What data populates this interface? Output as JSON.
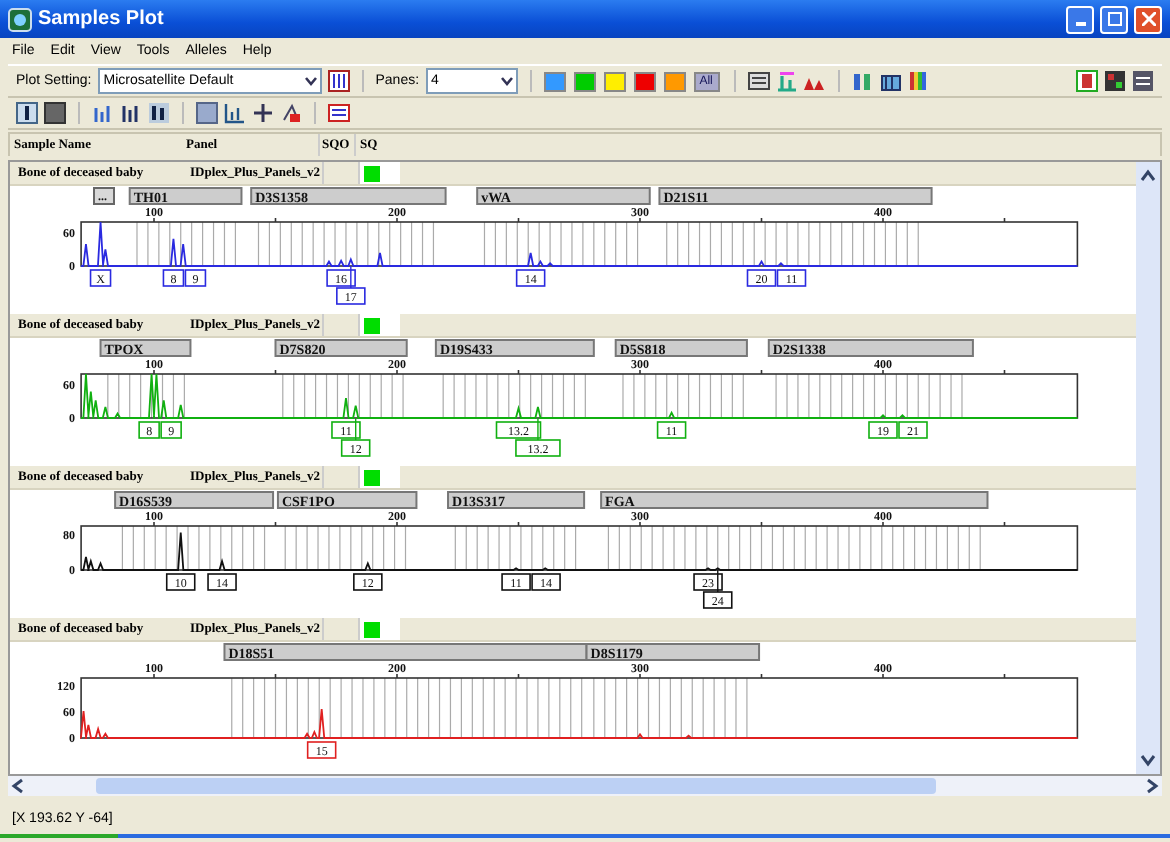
{
  "window": {
    "title": "Samples Plot"
  },
  "menu": [
    "File",
    "Edit",
    "View",
    "Tools",
    "Alleles",
    "Help"
  ],
  "toolbar": {
    "plot_setting_label": "Plot Setting:",
    "plot_setting": "Microsatellite Default",
    "panes_label": "Panes:",
    "panes": "4",
    "dye_buttons": [
      {
        "color": "#3399ff"
      },
      {
        "color": "#00cc00"
      },
      {
        "color": "#ffee00"
      },
      {
        "color": "#ee0000"
      },
      {
        "color": "#ff9900"
      },
      {
        "label": "All"
      }
    ]
  },
  "columns": [
    "Sample Name",
    "Panel",
    "SQO",
    "SQ"
  ],
  "panels": [
    {
      "sample": "Bone of deceased baby",
      "panel": "IDplex_Plus_Panels_v2",
      "sq": {
        "color": "#00dd00"
      },
      "color": "#2a2ae0",
      "more_button": "...",
      "loci": [
        "TH01",
        "D3S1358",
        "vWA",
        "D21S11"
      ],
      "xticks": [
        "100",
        "200",
        "300",
        "400"
      ],
      "yticks": [
        "60",
        "0"
      ],
      "alleles": [
        {
          "label": "X",
          "lower": false
        },
        {
          "label": "8",
          "lower": false
        },
        {
          "label": "9",
          "lower": false
        },
        {
          "label": "16",
          "lower": false
        },
        {
          "label": "17",
          "lower": true
        },
        {
          "label": "14",
          "lower": false
        },
        {
          "label": "20",
          "lower": false
        },
        {
          "label": "11",
          "lower": false
        }
      ]
    },
    {
      "sample": "Bone of deceased baby",
      "panel": "IDplex_Plus_Panels_v2",
      "sq": {
        "color": "#00dd00"
      },
      "color": "#10b010",
      "loci": [
        "TPOX",
        "D7S820",
        "D19S433",
        "D5S818",
        "D2S1338"
      ],
      "xticks": [
        "100",
        "200",
        "300",
        "400"
      ],
      "yticks": [
        "60",
        "0"
      ],
      "alleles": [
        {
          "label": "8",
          "lower": false
        },
        {
          "label": "9",
          "lower": false
        },
        {
          "label": "11",
          "lower": false
        },
        {
          "label": "12",
          "lower": true
        },
        {
          "label": "13.2",
          "lower": false
        },
        {
          "label": "13.2",
          "lower": true
        },
        {
          "label": "11",
          "lower": false
        },
        {
          "label": "19",
          "lower": false
        },
        {
          "label": "21",
          "lower": false
        }
      ]
    },
    {
      "sample": "Bone of deceased baby",
      "panel": "IDplex_Plus_Panels_v2",
      "sq": {
        "color": "#00dd00"
      },
      "color": "#111111",
      "loci": [
        "D16S539",
        "CSF1PO",
        "D13S317",
        "FGA"
      ],
      "xticks": [
        "100",
        "200",
        "300",
        "400"
      ],
      "yticks": [
        "80",
        "0"
      ],
      "alleles": [
        {
          "label": "10",
          "lower": false
        },
        {
          "label": "14",
          "lower": false
        },
        {
          "label": "12",
          "lower": false
        },
        {
          "label": "11",
          "lower": false
        },
        {
          "label": "14",
          "lower": false
        },
        {
          "label": "23",
          "lower": false
        },
        {
          "label": "24",
          "lower": true
        }
      ]
    },
    {
      "sample": "Bone of deceased baby",
      "panel": "IDplex_Plus_Panels_v2",
      "sq": {
        "color": "#00dd00"
      },
      "color": "#e02020",
      "loci": [
        "D18S51",
        "D8S1179"
      ],
      "xticks": [
        "100",
        "200",
        "300",
        "400"
      ],
      "yticks": [
        "120",
        "60",
        "0"
      ],
      "alleles": [
        {
          "label": "15",
          "lower": false
        }
      ]
    }
  ],
  "status_bar": {
    "text": "[X 193.62  Y -64]",
    "progress": {
      "level": 0.1
    }
  }
}
